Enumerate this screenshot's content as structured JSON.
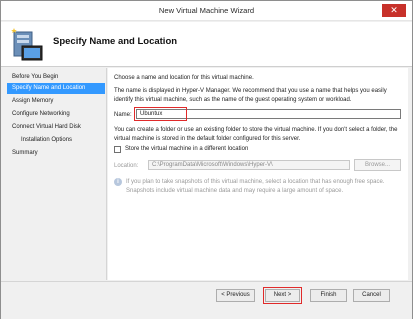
{
  "window": {
    "title": "New Virtual Machine Wizard",
    "close_glyph": "✕"
  },
  "header": {
    "title": "Specify Name and Location",
    "icon": "virtual-machine-icon"
  },
  "sidebar": {
    "items": [
      {
        "label": "Before You Begin"
      },
      {
        "label": "Specify Name and Location",
        "active": true
      },
      {
        "label": "Assign Memory"
      },
      {
        "label": "Configure Networking"
      },
      {
        "label": "Connect Virtual Hard Disk"
      },
      {
        "label": "Installation Options"
      },
      {
        "label": "Summary"
      }
    ]
  },
  "content": {
    "intro": "Choose a name and location for this virtual machine.",
    "description": "The name is displayed in Hyper-V Manager. We recommend that you use a name that helps you easily identify this virtual machine, such as the name of the guest operating system or workload.",
    "name_label": "Name:",
    "name_value": "Ubuntux",
    "folder_text": "You can create a folder or use an existing folder to store the virtual machine. If you don't select a folder, the virtual machine is stored in the default folder configured for this server.",
    "checkbox_label": "Store the virtual machine in a different location",
    "location_label": "Location:",
    "location_value": "C:\\ProgramData\\Microsoft\\Windows\\Hyper-V\\",
    "browse_label": "Browse...",
    "info_text": "If you plan to take snapshots of this virtual machine, select a location that has enough free space. Snapshots include virtual machine data and may require a large amount of space."
  },
  "footer": {
    "previous_label": "< Previous",
    "next_label": "Next >",
    "finish_label": "Finish",
    "cancel_label": "Cancel"
  },
  "colors": {
    "active_nav": "#3399ff",
    "highlight_box": "#e02a2a",
    "close_button": "#c7312a"
  }
}
